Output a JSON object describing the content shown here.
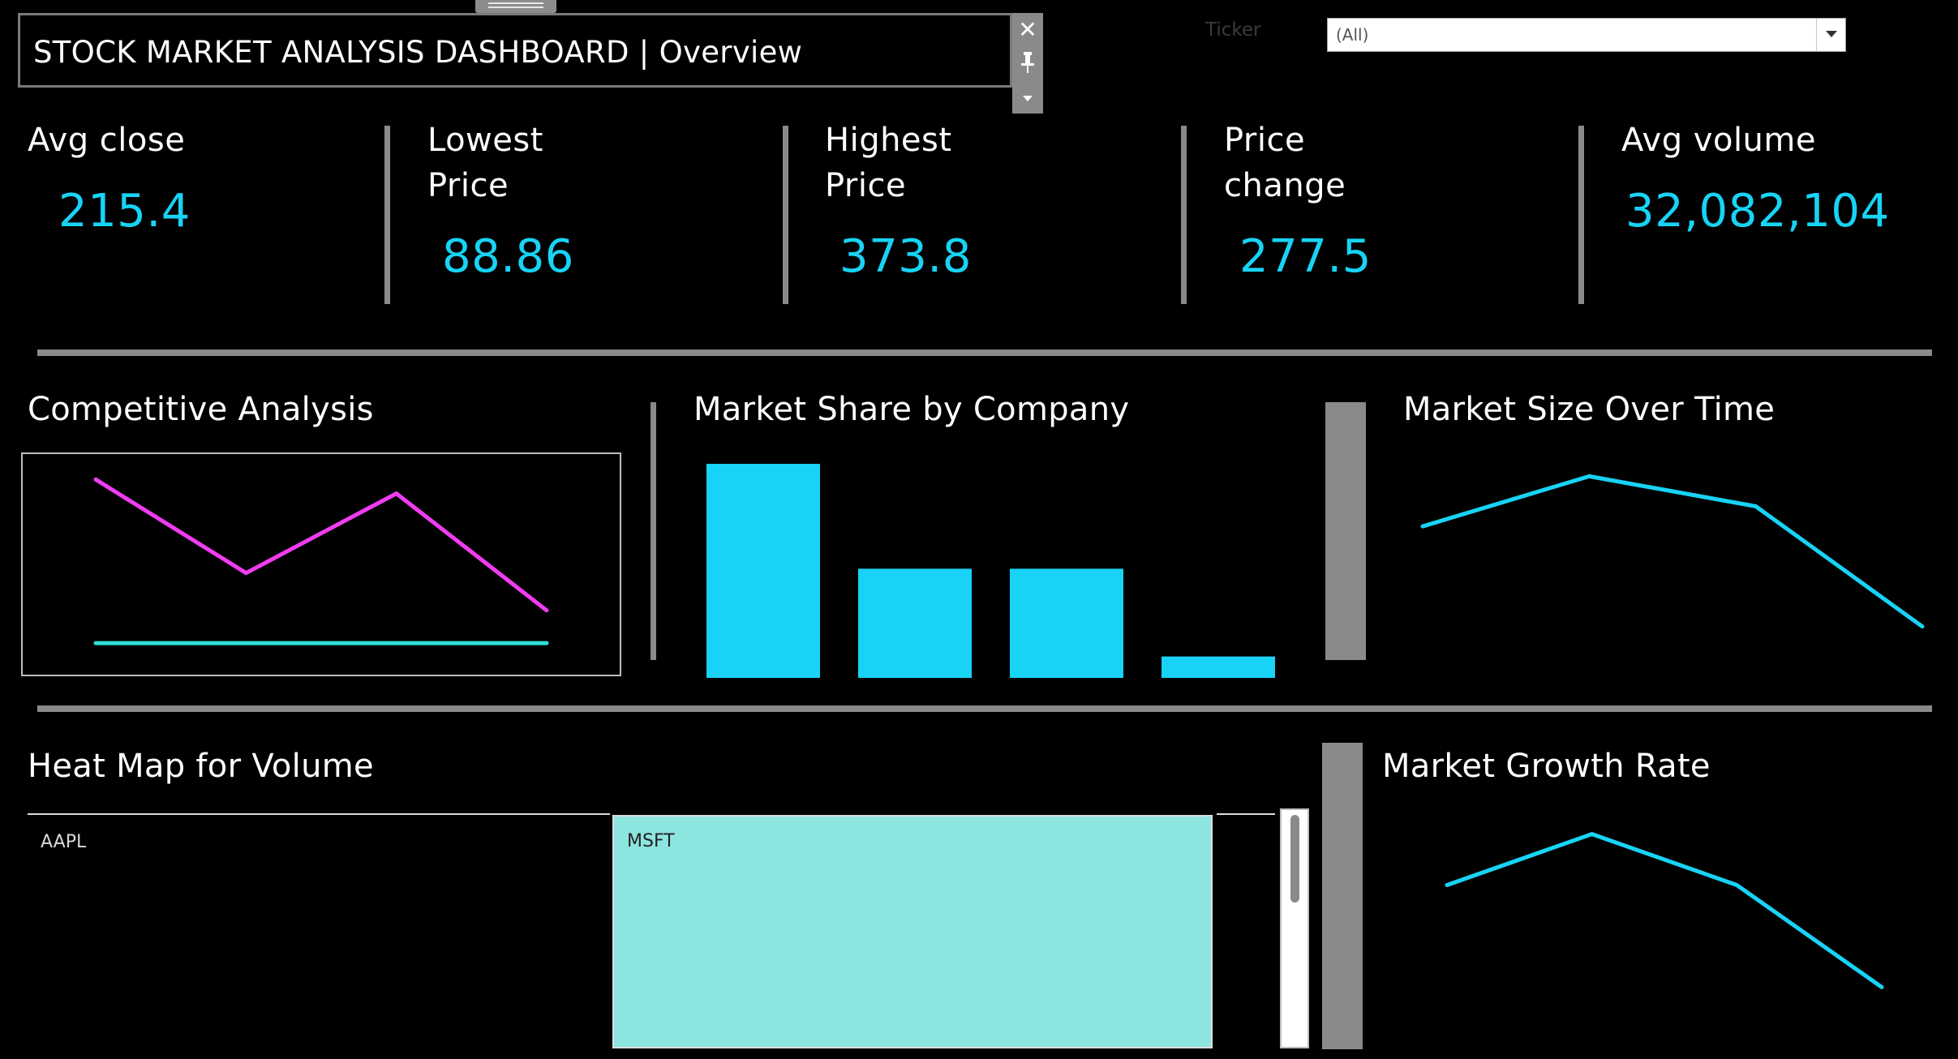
{
  "header": {
    "title": "STOCK MARKET ANALYSIS DASHBOARD | Overview",
    "toolbar": {
      "close_glyph": "✕",
      "pin_glyph": "📌",
      "more_glyph": "▾"
    }
  },
  "filter": {
    "label": "Ticker",
    "value": "(All)"
  },
  "kpis": [
    {
      "label_line1": "Avg close",
      "label_line2": "",
      "value": "215.4"
    },
    {
      "label_line1": "Lowest",
      "label_line2": "Price",
      "value": "88.86"
    },
    {
      "label_line1": "Highest",
      "label_line2": "Price",
      "value": "373.8"
    },
    {
      "label_line1": "Price",
      "label_line2": "change",
      "value": "277.5"
    },
    {
      "label_line1": "Avg volume",
      "label_line2": "",
      "value": "32,082,104"
    }
  ],
  "sections": {
    "competitive": "Competitive Analysis",
    "market_share": "Market Share by Company",
    "market_size": "Market Size Over Time",
    "heatmap": "Heat Map for Volume",
    "growth": "Market Growth Rate"
  },
  "colors": {
    "accent": "#18d3f5",
    "magenta": "#f03cf0",
    "teal": "#2ee0d6",
    "heat": "#8de5df",
    "divider": "#8a8a8a"
  },
  "chart_data": [
    {
      "id": "competitive-analysis",
      "type": "line",
      "x": [
        1,
        2,
        3,
        4
      ],
      "series": [
        {
          "values": [
            4.0,
            2.0,
            3.7,
            1.2
          ],
          "color": "#f03cf0"
        },
        {
          "values": [
            0.5,
            0.5,
            0.5,
            0.5
          ],
          "color": "#2ee0d6"
        }
      ],
      "ylim": [
        0,
        4.3
      ]
    },
    {
      "id": "market-share",
      "type": "bar",
      "categories": [
        "1",
        "2",
        "3",
        "4"
      ],
      "values": [
        100,
        51,
        51,
        10
      ],
      "ylim": [
        0,
        100
      ]
    },
    {
      "id": "market-size",
      "type": "line",
      "x": [
        1,
        2,
        3,
        4
      ],
      "series": [
        {
          "values": [
            2.0,
            3.0,
            2.4,
            0.0
          ],
          "color": "#18d3f5"
        }
      ],
      "ylim": [
        -0.2,
        3.2
      ]
    },
    {
      "id": "heatmap-volume",
      "type": "heatmap",
      "cells": [
        {
          "label": "AAPL",
          "color": "#000000"
        },
        {
          "label": "MSFT",
          "color": "#8de5df"
        }
      ]
    },
    {
      "id": "market-growth",
      "type": "line",
      "x": [
        1,
        2,
        3,
        4
      ],
      "series": [
        {
          "values": [
            2.0,
            3.0,
            2.0,
            0.0
          ],
          "color": "#18d3f5"
        }
      ],
      "ylim": [
        -0.2,
        3.2
      ]
    }
  ]
}
